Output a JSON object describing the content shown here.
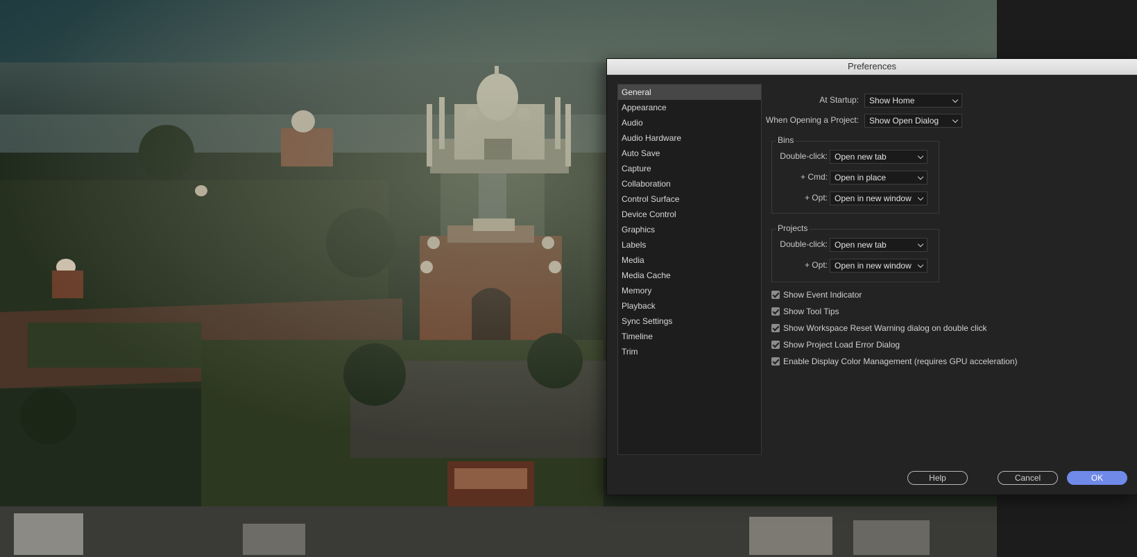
{
  "dialog": {
    "title": "Preferences"
  },
  "categories": [
    "General",
    "Appearance",
    "Audio",
    "Audio Hardware",
    "Auto Save",
    "Capture",
    "Collaboration",
    "Control Surface",
    "Device Control",
    "Graphics",
    "Labels",
    "Media",
    "Media Cache",
    "Memory",
    "Playback",
    "Sync Settings",
    "Timeline",
    "Trim"
  ],
  "selected_category": "General",
  "general": {
    "at_startup": {
      "label": "At Startup:",
      "value": "Show Home"
    },
    "when_opening_project": {
      "label": "When Opening a Project:",
      "value": "Show Open Dialog"
    },
    "bins": {
      "title": "Bins",
      "double_click": {
        "label": "Double-click:",
        "value": "Open new tab"
      },
      "cmd": {
        "label": "+ Cmd:",
        "value": "Open in place"
      },
      "opt": {
        "label": "+ Opt:",
        "value": "Open in new window"
      }
    },
    "projects": {
      "title": "Projects",
      "double_click": {
        "label": "Double-click:",
        "value": "Open new tab"
      },
      "opt": {
        "label": "+ Opt:",
        "value": "Open in new window"
      }
    },
    "checkboxes": [
      {
        "label": "Show Event Indicator",
        "checked": true
      },
      {
        "label": "Show Tool Tips",
        "checked": true
      },
      {
        "label": "Show Workspace Reset Warning dialog on double click",
        "checked": true
      },
      {
        "label": "Show Project Load Error Dialog",
        "checked": true
      },
      {
        "label": "Enable Display Color Management (requires GPU acceleration)",
        "checked": true
      }
    ]
  },
  "buttons": {
    "help": "Help",
    "cancel": "Cancel",
    "ok": "OK"
  },
  "colors": {
    "accent": "#6f8ae8",
    "panel": "#232323",
    "selection": "#474747"
  }
}
